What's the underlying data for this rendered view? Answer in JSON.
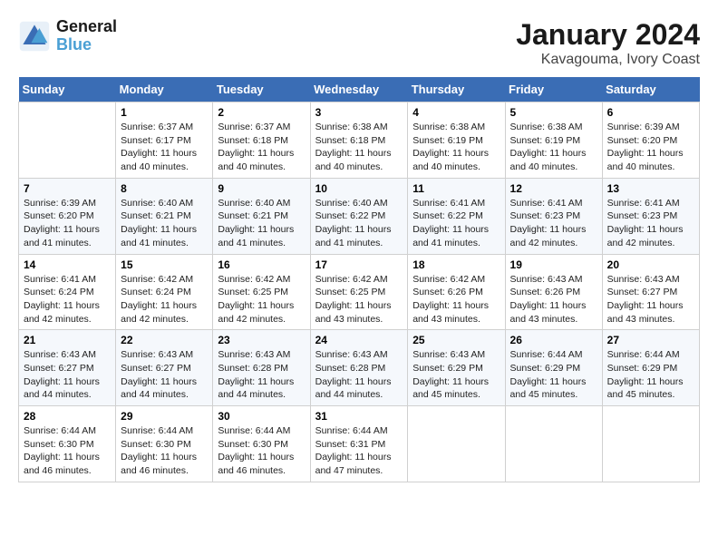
{
  "logo": {
    "line1": "General",
    "line2": "Blue"
  },
  "title": "January 2024",
  "subtitle": "Kavagouma, Ivory Coast",
  "header_days": [
    "Sunday",
    "Monday",
    "Tuesday",
    "Wednesday",
    "Thursday",
    "Friday",
    "Saturday"
  ],
  "weeks": [
    [
      {
        "day": "",
        "info": ""
      },
      {
        "day": "1",
        "info": "Sunrise: 6:37 AM\nSunset: 6:17 PM\nDaylight: 11 hours and 40 minutes."
      },
      {
        "day": "2",
        "info": "Sunrise: 6:37 AM\nSunset: 6:18 PM\nDaylight: 11 hours and 40 minutes."
      },
      {
        "day": "3",
        "info": "Sunrise: 6:38 AM\nSunset: 6:18 PM\nDaylight: 11 hours and 40 minutes."
      },
      {
        "day": "4",
        "info": "Sunrise: 6:38 AM\nSunset: 6:19 PM\nDaylight: 11 hours and 40 minutes."
      },
      {
        "day": "5",
        "info": "Sunrise: 6:38 AM\nSunset: 6:19 PM\nDaylight: 11 hours and 40 minutes."
      },
      {
        "day": "6",
        "info": "Sunrise: 6:39 AM\nSunset: 6:20 PM\nDaylight: 11 hours and 40 minutes."
      }
    ],
    [
      {
        "day": "7",
        "info": "Sunrise: 6:39 AM\nSunset: 6:20 PM\nDaylight: 11 hours and 41 minutes."
      },
      {
        "day": "8",
        "info": "Sunrise: 6:40 AM\nSunset: 6:21 PM\nDaylight: 11 hours and 41 minutes."
      },
      {
        "day": "9",
        "info": "Sunrise: 6:40 AM\nSunset: 6:21 PM\nDaylight: 11 hours and 41 minutes."
      },
      {
        "day": "10",
        "info": "Sunrise: 6:40 AM\nSunset: 6:22 PM\nDaylight: 11 hours and 41 minutes."
      },
      {
        "day": "11",
        "info": "Sunrise: 6:41 AM\nSunset: 6:22 PM\nDaylight: 11 hours and 41 minutes."
      },
      {
        "day": "12",
        "info": "Sunrise: 6:41 AM\nSunset: 6:23 PM\nDaylight: 11 hours and 42 minutes."
      },
      {
        "day": "13",
        "info": "Sunrise: 6:41 AM\nSunset: 6:23 PM\nDaylight: 11 hours and 42 minutes."
      }
    ],
    [
      {
        "day": "14",
        "info": "Sunrise: 6:41 AM\nSunset: 6:24 PM\nDaylight: 11 hours and 42 minutes."
      },
      {
        "day": "15",
        "info": "Sunrise: 6:42 AM\nSunset: 6:24 PM\nDaylight: 11 hours and 42 minutes."
      },
      {
        "day": "16",
        "info": "Sunrise: 6:42 AM\nSunset: 6:25 PM\nDaylight: 11 hours and 42 minutes."
      },
      {
        "day": "17",
        "info": "Sunrise: 6:42 AM\nSunset: 6:25 PM\nDaylight: 11 hours and 43 minutes."
      },
      {
        "day": "18",
        "info": "Sunrise: 6:42 AM\nSunset: 6:26 PM\nDaylight: 11 hours and 43 minutes."
      },
      {
        "day": "19",
        "info": "Sunrise: 6:43 AM\nSunset: 6:26 PM\nDaylight: 11 hours and 43 minutes."
      },
      {
        "day": "20",
        "info": "Sunrise: 6:43 AM\nSunset: 6:27 PM\nDaylight: 11 hours and 43 minutes."
      }
    ],
    [
      {
        "day": "21",
        "info": "Sunrise: 6:43 AM\nSunset: 6:27 PM\nDaylight: 11 hours and 44 minutes."
      },
      {
        "day": "22",
        "info": "Sunrise: 6:43 AM\nSunset: 6:27 PM\nDaylight: 11 hours and 44 minutes."
      },
      {
        "day": "23",
        "info": "Sunrise: 6:43 AM\nSunset: 6:28 PM\nDaylight: 11 hours and 44 minutes."
      },
      {
        "day": "24",
        "info": "Sunrise: 6:43 AM\nSunset: 6:28 PM\nDaylight: 11 hours and 44 minutes."
      },
      {
        "day": "25",
        "info": "Sunrise: 6:43 AM\nSunset: 6:29 PM\nDaylight: 11 hours and 45 minutes."
      },
      {
        "day": "26",
        "info": "Sunrise: 6:44 AM\nSunset: 6:29 PM\nDaylight: 11 hours and 45 minutes."
      },
      {
        "day": "27",
        "info": "Sunrise: 6:44 AM\nSunset: 6:29 PM\nDaylight: 11 hours and 45 minutes."
      }
    ],
    [
      {
        "day": "28",
        "info": "Sunrise: 6:44 AM\nSunset: 6:30 PM\nDaylight: 11 hours and 46 minutes."
      },
      {
        "day": "29",
        "info": "Sunrise: 6:44 AM\nSunset: 6:30 PM\nDaylight: 11 hours and 46 minutes."
      },
      {
        "day": "30",
        "info": "Sunrise: 6:44 AM\nSunset: 6:30 PM\nDaylight: 11 hours and 46 minutes."
      },
      {
        "day": "31",
        "info": "Sunrise: 6:44 AM\nSunset: 6:31 PM\nDaylight: 11 hours and 47 minutes."
      },
      {
        "day": "",
        "info": ""
      },
      {
        "day": "",
        "info": ""
      },
      {
        "day": "",
        "info": ""
      }
    ]
  ]
}
